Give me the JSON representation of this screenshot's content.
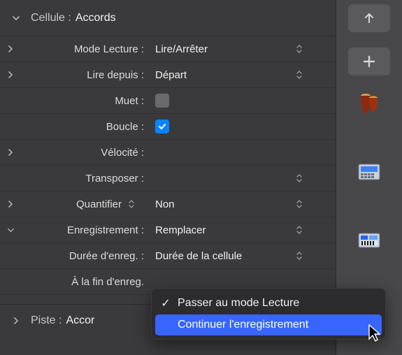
{
  "header": {
    "label": "Cellule :",
    "value": "Accords"
  },
  "rows": {
    "play_mode": {
      "label": "Mode Lecture :",
      "value": "Lire/Arrêter"
    },
    "play_from": {
      "label": "Lire depuis :",
      "value": "Départ"
    },
    "mute": {
      "label": "Muet :"
    },
    "loop": {
      "label": "Boucle :"
    },
    "velocity": {
      "label": "Vélocité :"
    },
    "transpose": {
      "label": "Transposer :"
    },
    "quantize": {
      "label": "Quantifier",
      "value": "Non"
    },
    "record": {
      "label": "Enregistrement :",
      "value": "Remplacer"
    },
    "rec_length": {
      "label": "Durée d'enreg. :",
      "value": "Durée de la cellule"
    },
    "rec_end": {
      "label": "À la fin d'enreg."
    }
  },
  "track": {
    "label": "Piste :",
    "value": "Accor"
  },
  "popup": {
    "option1": "Passer au mode Lecture",
    "option2": "Continuer l'enregistrement"
  }
}
